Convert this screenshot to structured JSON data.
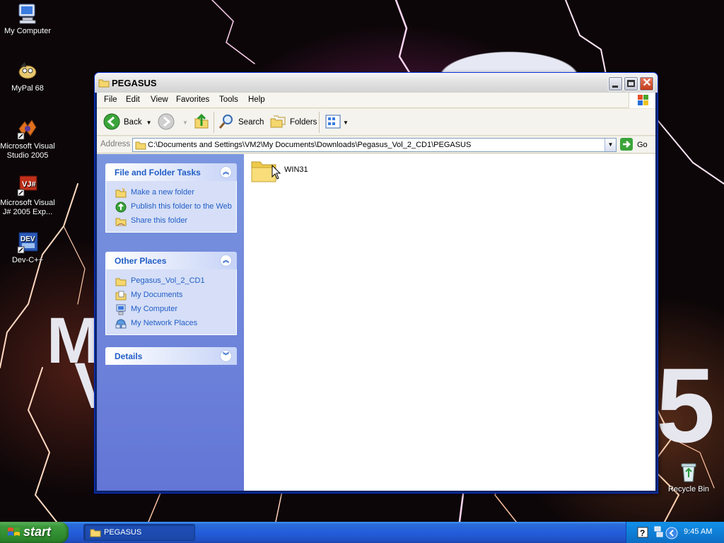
{
  "desktop": {
    "icons": [
      {
        "label": "My Computer",
        "icon": "my-computer-icon"
      },
      {
        "label": "MyPal 68",
        "icon": "mypal-icon"
      },
      {
        "label": "Microsoft Visual Studio 2005",
        "icon": "visual-studio-icon"
      },
      {
        "label": "Microsoft Visual J# 2005 Exp...",
        "icon": "visual-jsharp-icon"
      },
      {
        "label": "Dev-C++",
        "icon": "devcpp-icon"
      },
      {
        "label": "Recycle Bin",
        "icon": "recycle-bin-icon"
      }
    ],
    "wallpaper_letters": {
      "m": "M",
      "v": "V",
      "five": "5"
    }
  },
  "window": {
    "title": "PEGASUS",
    "menu": [
      "File",
      "Edit",
      "View",
      "Favorites",
      "Tools",
      "Help"
    ],
    "toolbar": {
      "back_label": "Back",
      "search_label": "Search",
      "folders_label": "Folders"
    },
    "address": {
      "label": "Address",
      "path": "C:\\Documents and Settings\\VM2\\My Documents\\Downloads\\Pegasus_Vol_2_CD1\\PEGASUS",
      "go_label": "Go"
    },
    "taskpane": {
      "file_tasks": {
        "title": "File and Folder Tasks",
        "items": [
          "Make a new folder",
          "Publish this folder to the Web",
          "Share this folder"
        ]
      },
      "other_places": {
        "title": "Other Places",
        "items": [
          "Pegasus_Vol_2_CD1",
          "My Documents",
          "My Computer",
          "My Network Places"
        ]
      },
      "details": {
        "title": "Details"
      }
    },
    "files": [
      {
        "name": "WIN31",
        "type": "folder"
      }
    ]
  },
  "taskbar": {
    "start_label": "start",
    "tasks": [
      {
        "label": "PEGASUS"
      }
    ],
    "clock": "9:45 AM"
  },
  "colors": {
    "taskbar_blue": "#245edb",
    "start_green": "#3c9a3c",
    "taskpane_blue": "#6375d6",
    "link_blue": "#215dc6"
  }
}
